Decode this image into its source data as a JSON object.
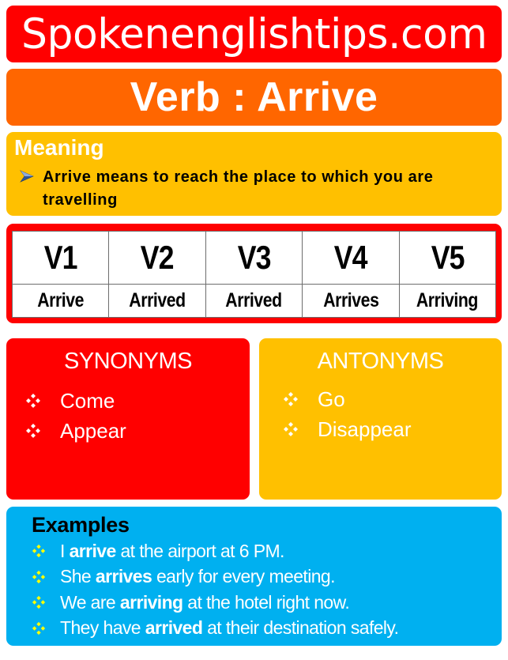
{
  "site": {
    "title": "Spokenenglishtips.com"
  },
  "verb": {
    "title": "Verb : Arrive"
  },
  "meaning": {
    "heading": "Meaning",
    "bullet_icon": "arrow-bullet-icon",
    "text": "Arrive means to reach the place to which you are travelling"
  },
  "forms": {
    "headers": [
      "V1",
      "V2",
      "V3",
      "V4",
      "V5"
    ],
    "values": [
      "Arrive",
      "Arrived",
      "Arrived",
      "Arrives",
      "Arriving"
    ]
  },
  "synonyms": {
    "heading": "SYNONYMS",
    "bullet_icon": "diamond-bullet-icon",
    "items": [
      "Come",
      "Appear"
    ]
  },
  "antonyms": {
    "heading": "ANTONYMS",
    "bullet_icon": "diamond-bullet-icon",
    "items": [
      "Go",
      "Disappear"
    ]
  },
  "examples": {
    "heading": "Examples",
    "bullet_icon": "diamond-bullet-icon",
    "items": [
      {
        "before": "I ",
        "bold": "arrive",
        "after": " at the airport at 6 PM."
      },
      {
        "before": "She ",
        "bold": "arrives",
        "after": " early for every meeting."
      },
      {
        "before": "We are ",
        "bold": "arriving",
        "after": " at the hotel right now."
      },
      {
        "before": "They have ",
        "bold": "arrived",
        "after": " at their destination safely."
      }
    ]
  },
  "colors": {
    "site_banner": "#ff0000",
    "verb_banner": "#ff6600",
    "meaning_panel": "#ffc000",
    "forms_border": "#ff0000",
    "synonyms_panel": "#ff0000",
    "antonyms_panel": "#ffc000",
    "examples_panel": "#00b0f0",
    "example_bullet": "#ffff00"
  }
}
